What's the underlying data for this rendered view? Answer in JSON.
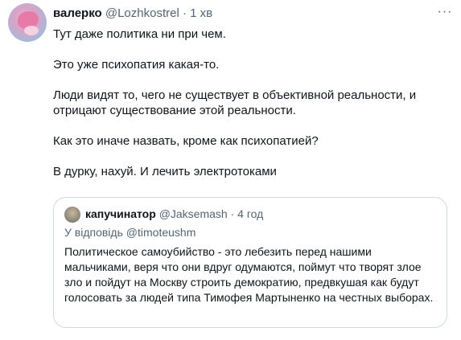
{
  "tweet": {
    "author_name": "валерко",
    "author_handle": "@Lozhkostrel",
    "separator": "·",
    "time": "1 хв",
    "more_label": "···",
    "paragraphs": [
      "Тут даже политика ни при чем.",
      "Это уже психопатия какая-то.",
      "Люди видят то, чего не существует в объективной реальности, и отрицают существование этой реальности.",
      "Как это иначе назвать, кроме как психопатией?",
      "В дурку, нахуй. И лечить электротоками"
    ]
  },
  "quoted": {
    "author_name": "капучинатор",
    "author_handle": "@Jaksemash",
    "separator": "·",
    "time": "4 год",
    "reply_prefix": "У відповідь",
    "reply_handle": "@timoteushm",
    "text": "Политическое самоубийство - это лебезить перед нашими мальчиками, веря что они вдруг одумаются, поймут что творят злое зло и пойдут на Москву строить демократию, предвкушая как будут голосовать за людей типа Тимофея Мартыненко на честных выборах."
  }
}
